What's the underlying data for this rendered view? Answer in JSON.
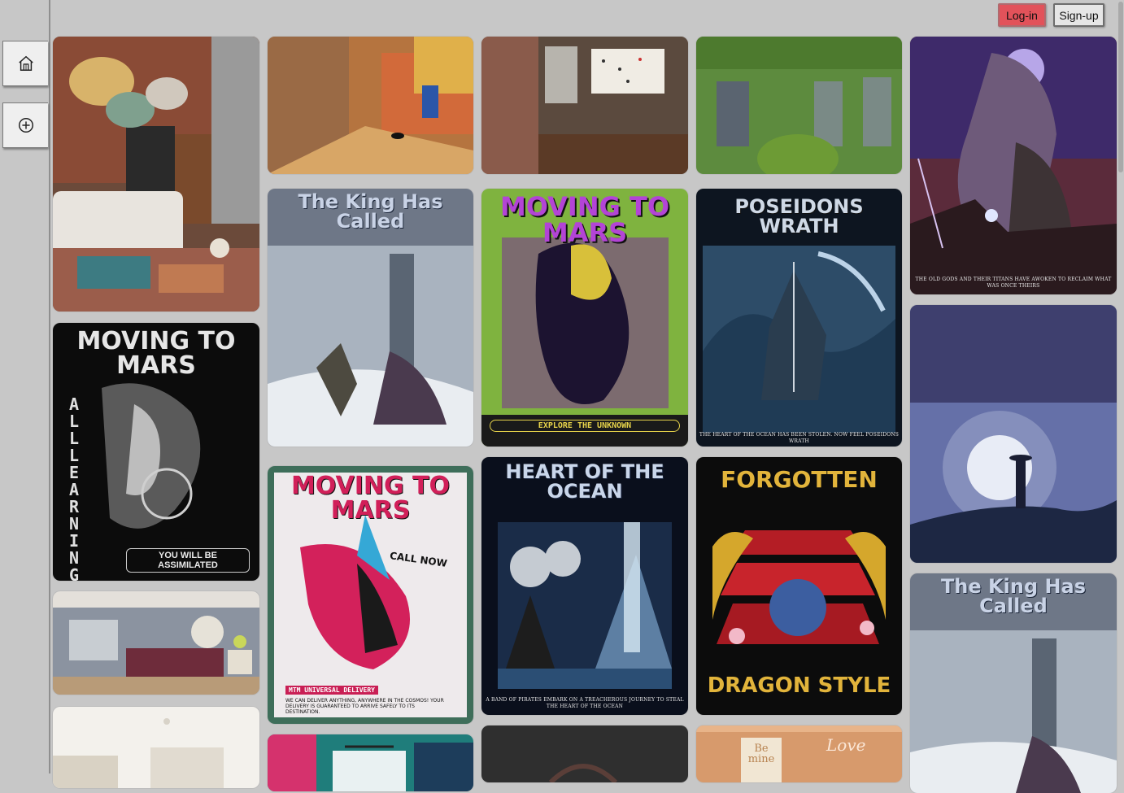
{
  "header": {
    "login_label": "Log-in",
    "signup_label": "Sign-up"
  },
  "sidebar": {
    "items": [
      {
        "icon": "home-icon"
      },
      {
        "icon": "add-circle-icon"
      }
    ]
  },
  "posters": {
    "king_title": "The King Has Called",
    "mars1_title": "MOVING TO MARS",
    "mars1_footer": "EXPLORE THE UNKNOWN",
    "poseidon_title": "POSEIDONS WRATH",
    "poseidon_caption": "THE HEART OF THE OCEAN HAS BEEN STOLEN. NOW FEEL POSEIDONS WRATH",
    "oldgods_caption": "THE OLD GODS AND THEIR TITANS HAVE AWOKEN TO RECLAIM WHAT WAS ONCE THEIRS",
    "mars2_title": "MOVING TO MARS",
    "mars2_side": "ALL LEARNING",
    "mars2_footer": "YOU WILL BE ASSIMILATED",
    "mars3_title": "MOVING TO MARS",
    "mars3_call": "CALL NOW",
    "mars3_delivery": "MTM UNIVERSAL DELIVERY",
    "mars3_body": "WE CAN DELIVER ANYTHING, ANYWHERE IN THE COSMOS! YOUR DELIVERY IS GUARANTEED TO ARRIVE SAFELY TO ITS DESTINATION.",
    "ocean_title": "HEART OF THE OCEAN",
    "ocean_caption": "A BAND OF PIRATES EMBARK ON A TREACHEROUS JOURNEY TO STEAL THE HEART OF THE OCEAN",
    "dragon_top": "FORGOTTEN",
    "dragon_bottom": "DRAGON STYLE",
    "wall_text": "Be mine",
    "neon_text": "Love"
  }
}
